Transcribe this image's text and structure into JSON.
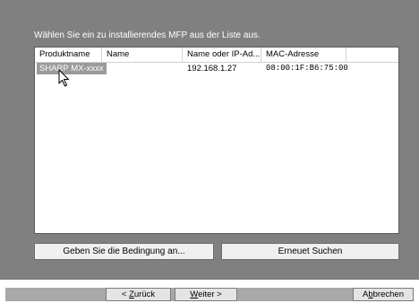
{
  "instruction": "Wählen Sie ein zu installierendes MFP aus der Liste aus.",
  "table": {
    "columns": [
      "Produktname",
      "Name",
      "Name oder IP-Ad...",
      "MAC-Adresse"
    ],
    "rows": [
      {
        "product_name": "SHARP MX-xxxx",
        "name": "",
        "ip": "192.168.1.27",
        "mac": "08:00:1F:B6:75:00",
        "selected": true
      }
    ]
  },
  "buttons": {
    "condition": "Geben Sie die Bedingung an...",
    "research": "Erneuet Suchen"
  },
  "footer": {
    "back_prefix": "< ",
    "back_key": "Z",
    "back_rest": "urück",
    "next_key": "W",
    "next_rest": "eiter >",
    "cancel_prefix": "A",
    "cancel_key": "b",
    "cancel_rest": "brechen"
  },
  "colors": {
    "panel_bg": "#808080",
    "selection_bg": "#9a9a9a"
  },
  "icons": {
    "cursor": "mouse-pointer-icon"
  }
}
